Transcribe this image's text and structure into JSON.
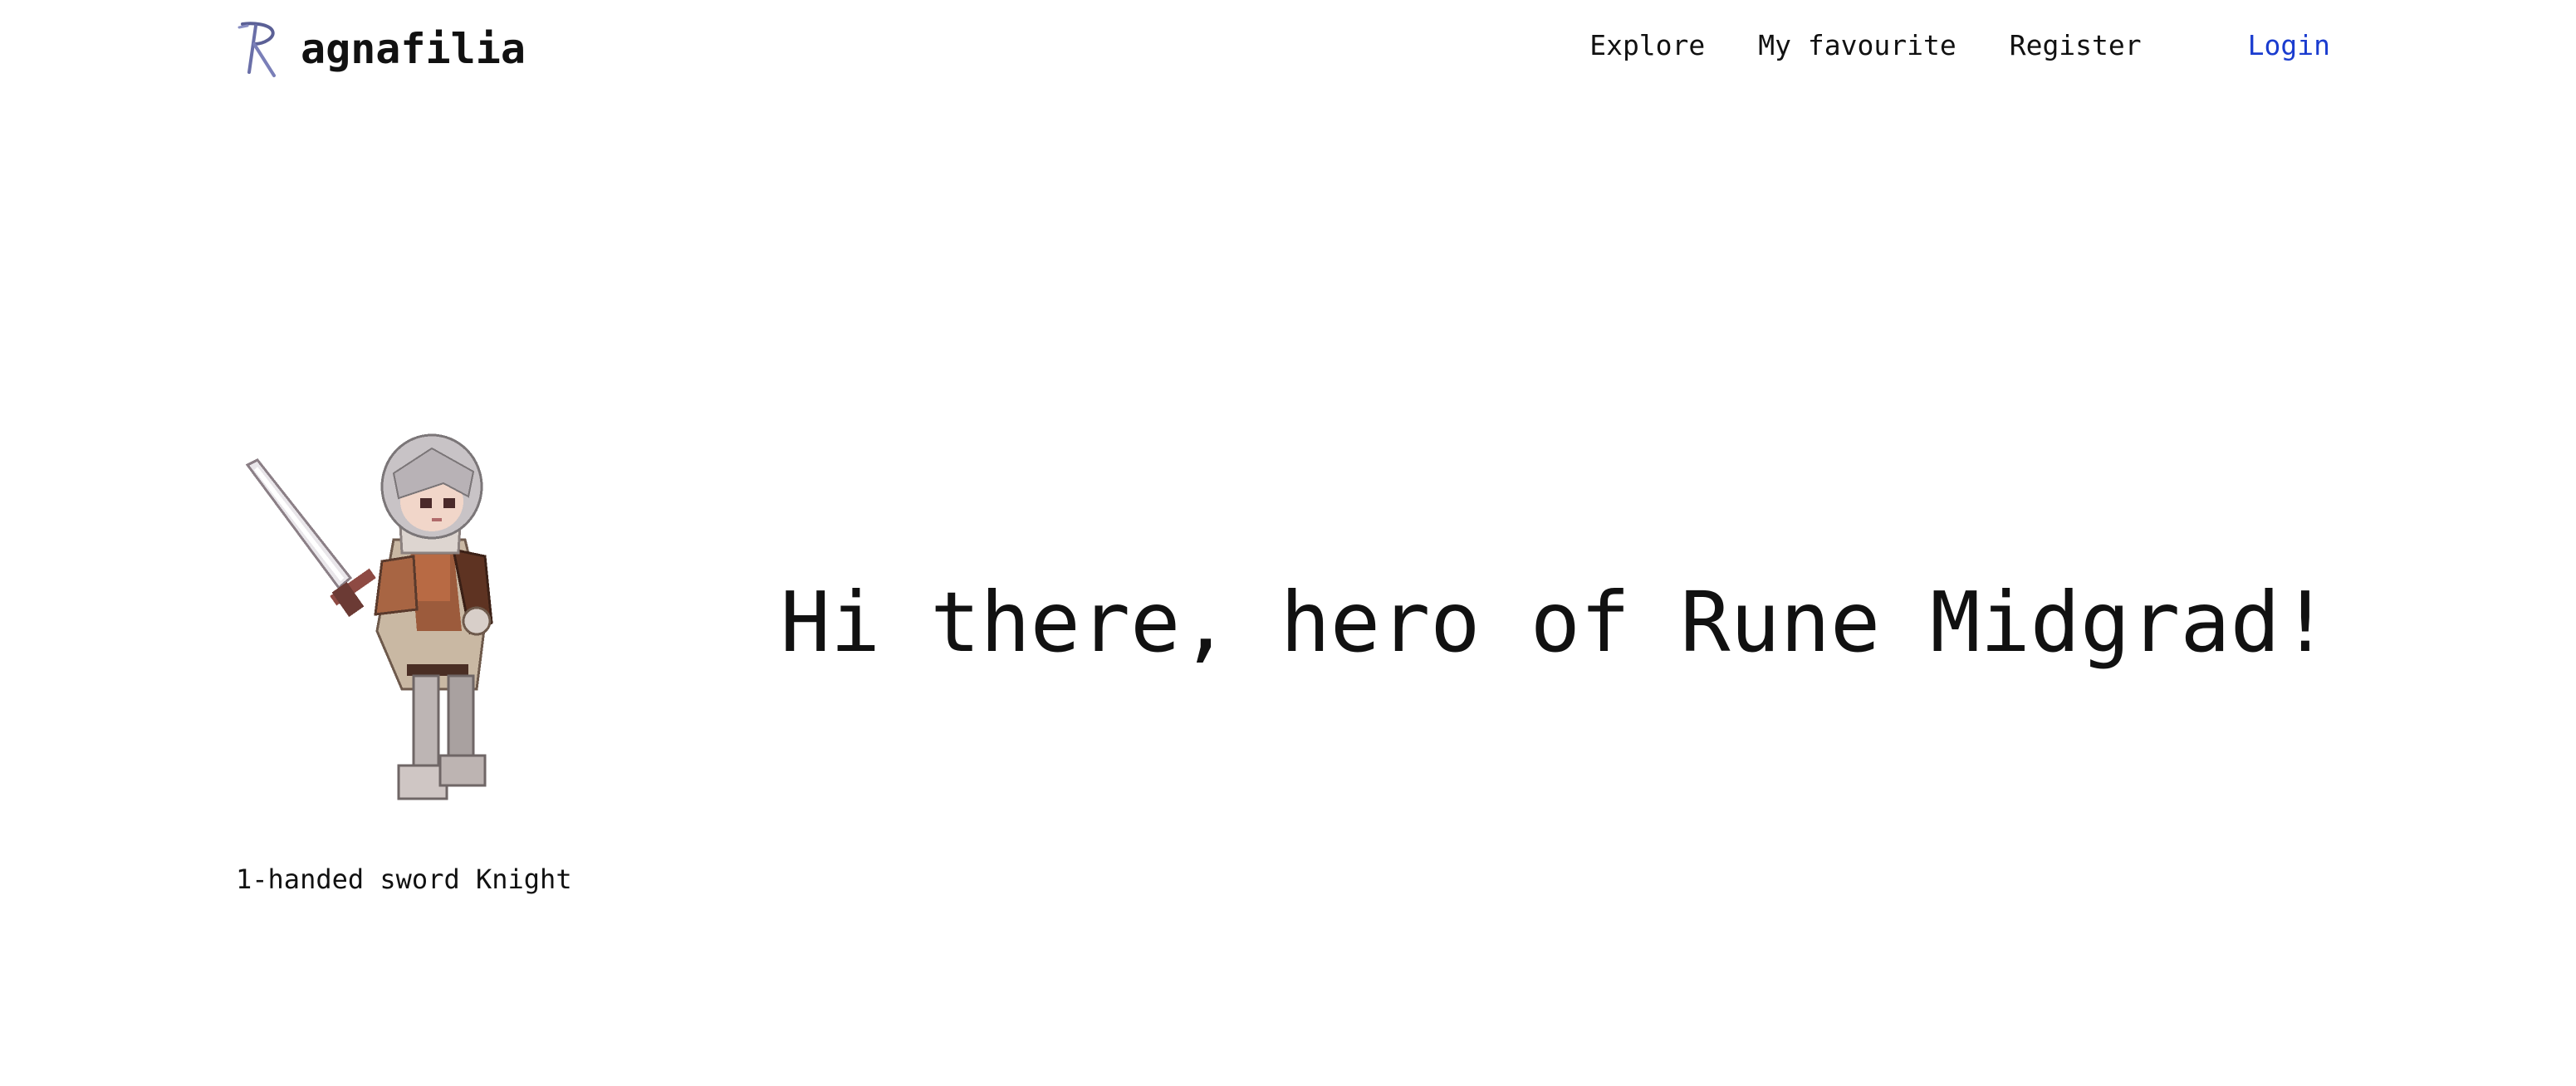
{
  "brand": {
    "name": "agnafilia",
    "logo_icon": "rune-r-logo-icon"
  },
  "nav": {
    "explore": "Explore",
    "favourite": "My favourite",
    "register": "Register",
    "login": "Login"
  },
  "hero": {
    "title": "Hi there, hero of Rune Midgrad!",
    "sprite_icon": "knight-sprite",
    "sprite_caption": "1-handed sword Knight"
  },
  "colors": {
    "accent": "#1a3ccf",
    "text": "#111111",
    "background": "#ffffff",
    "logo": "#6a6fa8"
  }
}
